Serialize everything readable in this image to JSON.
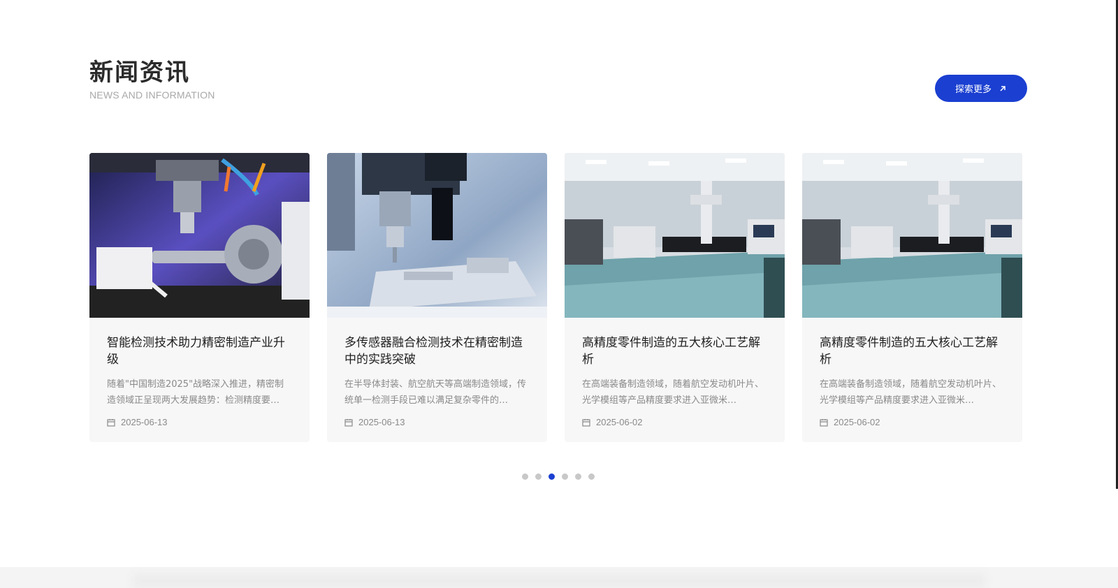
{
  "header": {
    "title": "新闻资讯",
    "subtitle": "NEWS AND INFORMATION",
    "more_label": "探索更多",
    "more_icon": "arrow-up-right-icon",
    "accent_color": "#1b3fd1"
  },
  "cards": [
    {
      "image": "cnc-machining-photo",
      "title": "智能检测技术助力精密制造产业升级",
      "desc": "随着\"中国制造2025\"战略深入推进，精密制造领域正呈现两大发展趋势：检测精度要…",
      "date": "2025-06-13"
    },
    {
      "image": "sensor-probe-photo",
      "title": "多传感器融合检测技术在精密制造中的实践突破",
      "desc": "在半导体封装、航空航天等高端制造领域，传统单一检测手段已难以满足复杂零件的…",
      "date": "2025-06-13"
    },
    {
      "image": "cmm-laboratory-photo",
      "title": "高精度零件制造的五大核心工艺解析",
      "desc": "在高端装备制造领域，随着航空发动机叶片、光学模组等产品精度要求进入亚微米…",
      "date": "2025-06-02"
    },
    {
      "image": "cmm-laboratory-photo",
      "title": "高精度零件制造的五大核心工艺解析",
      "desc": "在高端装备制造领域，随着航空发动机叶片、光学模组等产品精度要求进入亚微米…",
      "date": "2025-06-02"
    }
  ],
  "date_icon": "calendar-icon",
  "pagination": {
    "count": 6,
    "active_index": 2
  }
}
